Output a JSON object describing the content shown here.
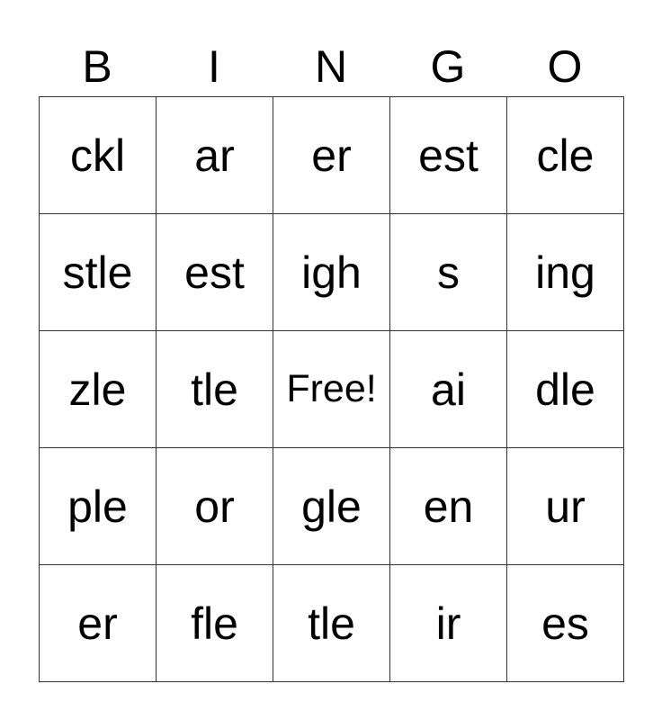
{
  "header": [
    "B",
    "I",
    "N",
    "G",
    "O"
  ],
  "rows": [
    [
      "ckl",
      "ar",
      "er",
      "est",
      "cle"
    ],
    [
      "stle",
      "est",
      "igh",
      "s",
      "ing"
    ],
    [
      "zle",
      "tle",
      "Free!",
      "ai",
      "dle"
    ],
    [
      "ple",
      "or",
      "gle",
      "en",
      "ur"
    ],
    [
      "er",
      "fle",
      "tle",
      "ir",
      "es"
    ]
  ]
}
